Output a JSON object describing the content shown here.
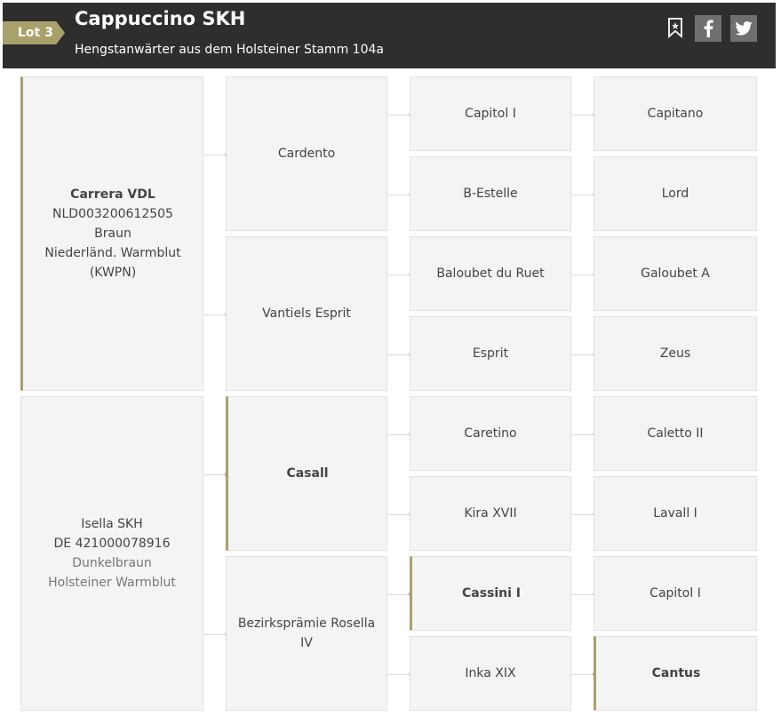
{
  "header": {
    "lot": "Lot 3",
    "title": "Cappuccino SKH",
    "subtitle": "Hengstanwärter aus dem Holsteiner Stamm 104a",
    "icons": [
      "bookmark-icon",
      "facebook-icon",
      "twitter-icon"
    ]
  },
  "pedigree": {
    "sire": {
      "name": "Carrera VDL",
      "reg": "NLD003200612505",
      "color": "Braun",
      "breed": "Niederländ. Warmblut (KWPN)"
    },
    "dam": {
      "name": "Isella SKH",
      "reg": "DE 421000078916",
      "color": "Dunkelbraun",
      "breed": "Holsteiner Warmblut"
    },
    "gen2": [
      "Cardento",
      "Vantiels Esprit",
      "Casall",
      "Bezirksprämie Rosella IV"
    ],
    "gen3": [
      "Capitol I",
      "B-Estelle",
      "Baloubet du Ruet",
      "Esprit",
      "Caretino",
      "Kira XVII",
      "Cassini I",
      "Inka XIX"
    ],
    "gen4": [
      "Capitano",
      "Lord",
      "Galoubet A",
      "Zeus",
      "Caletto II",
      "Lavall I",
      "Capitol I",
      "Cantus"
    ]
  }
}
